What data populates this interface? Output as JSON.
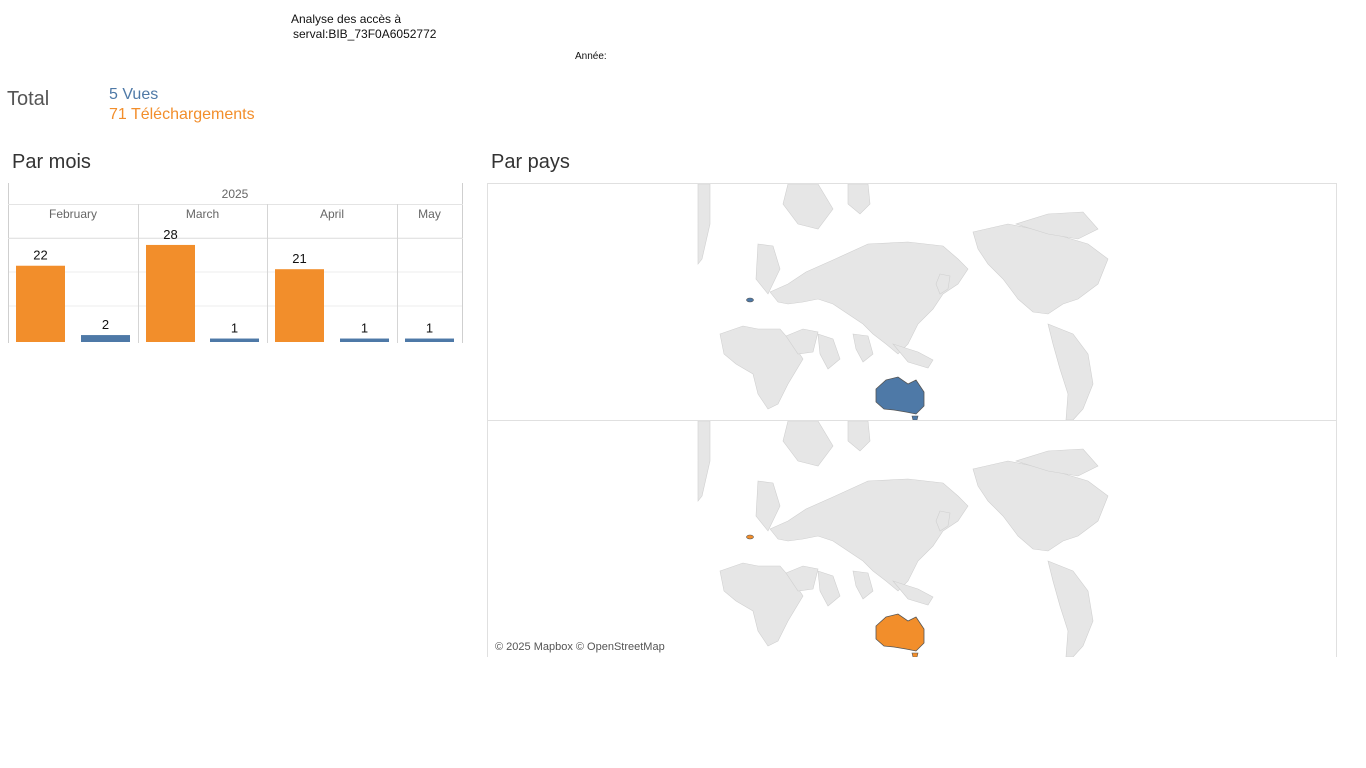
{
  "header": {
    "title_line1": "Analyse des accès à",
    "title_line2": "serval:BIB_73F0A6052772",
    "year_label": "Année:"
  },
  "totals": {
    "label": "Total",
    "views": "5 Vues",
    "downloads": "71 Téléchargements"
  },
  "sections": {
    "by_month": "Par mois",
    "by_country": "Par pays"
  },
  "colors": {
    "views": "#4e79a7",
    "downloads": "#f28e2b",
    "land": "#e6e6e6"
  },
  "chart_data": {
    "type": "bar",
    "year": "2025",
    "categories": [
      "February",
      "March",
      "April",
      "May"
    ],
    "series": [
      {
        "name": "Téléchargements",
        "values": [
          22,
          28,
          21,
          null
        ]
      },
      {
        "name": "Vues",
        "values": [
          2,
          1,
          1,
          1
        ]
      }
    ],
    "ylim": [
      0,
      30
    ],
    "grid": true
  },
  "maps": {
    "top": {
      "metric": "Vues",
      "highlighted": [
        "Australia",
        "Switzerland"
      ]
    },
    "bottom": {
      "metric": "Téléchargements",
      "highlighted": [
        "Australia",
        "Switzerland"
      ]
    },
    "attribution": "© 2025 Mapbox © OpenStreetMap"
  }
}
